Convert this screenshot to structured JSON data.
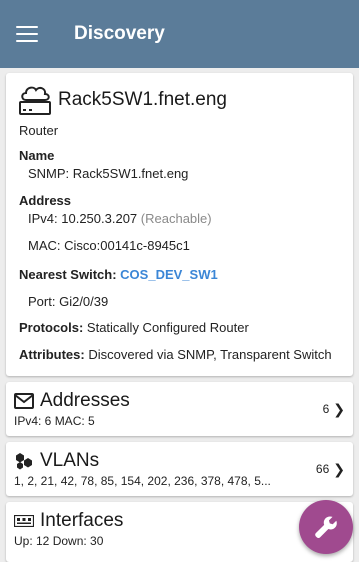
{
  "appbar": {
    "title": "Discovery"
  },
  "device": {
    "name": "Rack5SW1.fnet.eng",
    "type": "Router",
    "name_label": "Name",
    "snmp_label": "SNMP:",
    "snmp_value": "Rack5SW1.fnet.eng",
    "address_label": "Address",
    "ipv4_label": "IPv4:",
    "ipv4_value": "10.250.3.207",
    "ipv4_status": "(Reachable)",
    "mac_label": "MAC:",
    "mac_value": "Cisco:00141c-8945c1",
    "nearest_switch_label": "Nearest Switch:",
    "nearest_switch_value": "COS_DEV_SW1",
    "port_label": "Port:",
    "port_value": "Gi2/0/39",
    "protocols_label": "Protocols:",
    "protocols_value": "Statically Configured Router",
    "attributes_label": "Attributes:",
    "attributes_value": "Discovered via SNMP, Transparent Switch"
  },
  "addresses": {
    "title": "Addresses",
    "summary": "IPv4: 6   MAC: 5",
    "count": "6"
  },
  "vlans": {
    "title": "VLANs",
    "summary": "1, 2, 21, 42, 78, 85, 154, 202, 236, 378, 478, 5...",
    "count": "66"
  },
  "interfaces": {
    "title": "Interfaces",
    "summary": "Up: 12   Down: 30"
  },
  "colors": {
    "appbar": "#5b7c99",
    "link": "#3b86d6",
    "fab": "#a04a8f"
  }
}
